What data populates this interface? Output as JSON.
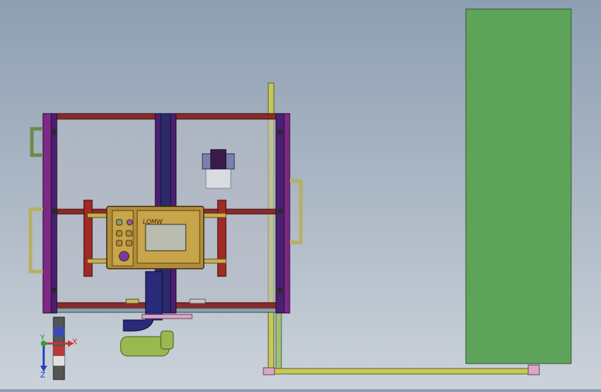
{
  "viewport": {
    "background_top": "#8e9fb3",
    "background_bottom": "#cbd2da"
  },
  "hmi_panel": {
    "brand_text": "LQMW",
    "body_color": "#b08d3a",
    "screen_color": "#b9bdb0"
  },
  "triad": {
    "x_label": "X",
    "y_label": "Y",
    "z_label": "Z"
  },
  "colors": {
    "green_panel": "#5ea35a",
    "frame_purple": "#7d2a86",
    "frame_red": "#a02a24",
    "yellow_rail": "#c8c85a",
    "blue_hose": "#2a2a7a",
    "green_motor": "#9ab850"
  }
}
